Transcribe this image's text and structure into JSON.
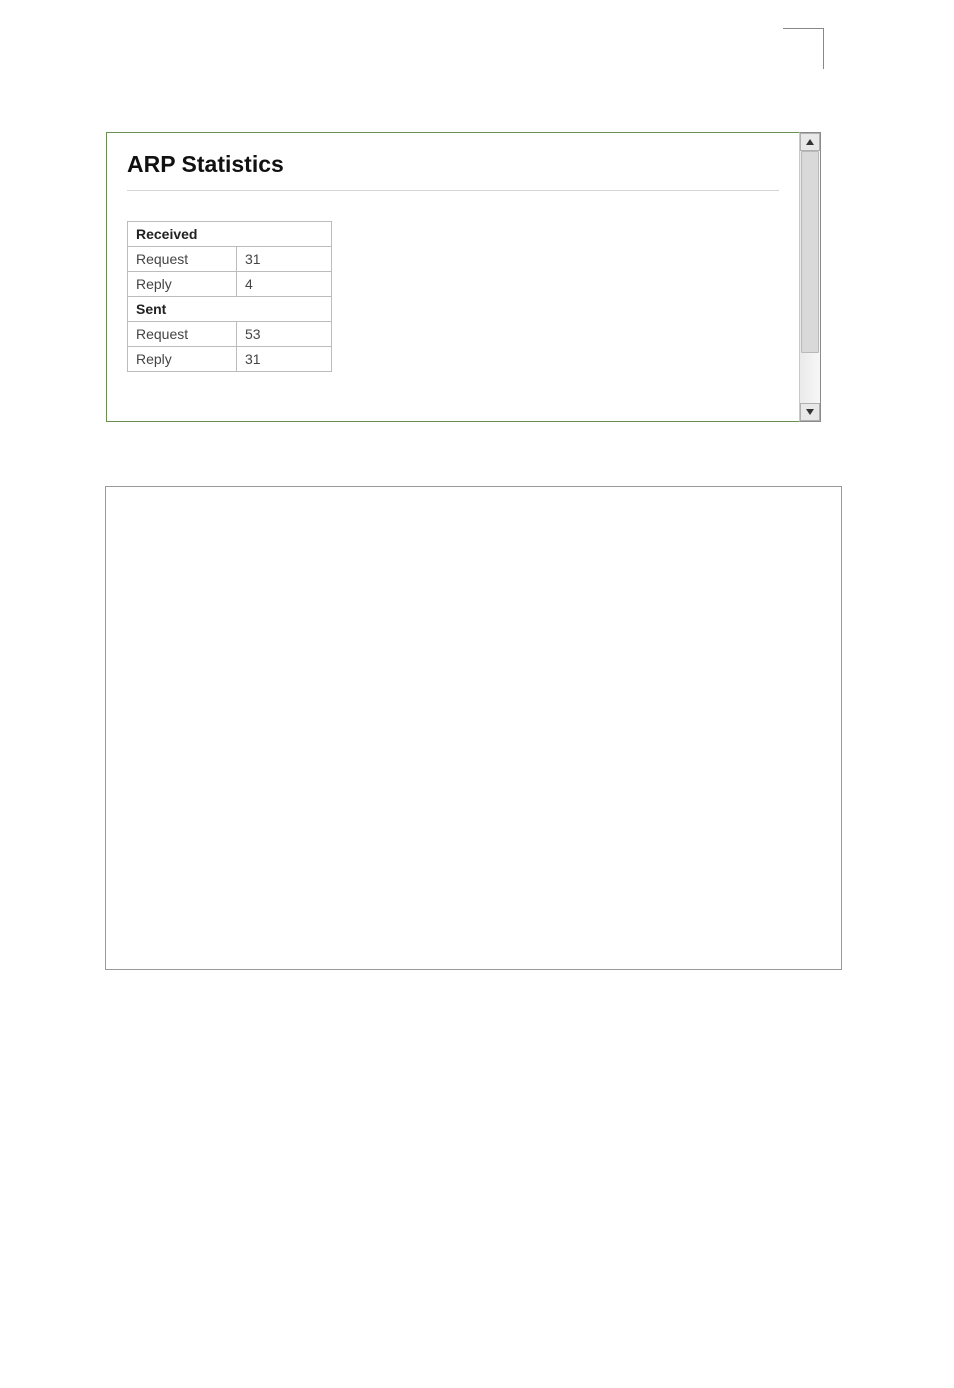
{
  "panel": {
    "title": "ARP Statistics",
    "sections": [
      {
        "header": "Received",
        "rows": [
          {
            "label": "Request",
            "value": "31"
          },
          {
            "label": "Reply",
            "value": "4"
          }
        ]
      },
      {
        "header": "Sent",
        "rows": [
          {
            "label": "Request",
            "value": "53"
          },
          {
            "label": "Reply",
            "value": "31"
          }
        ]
      }
    ]
  }
}
